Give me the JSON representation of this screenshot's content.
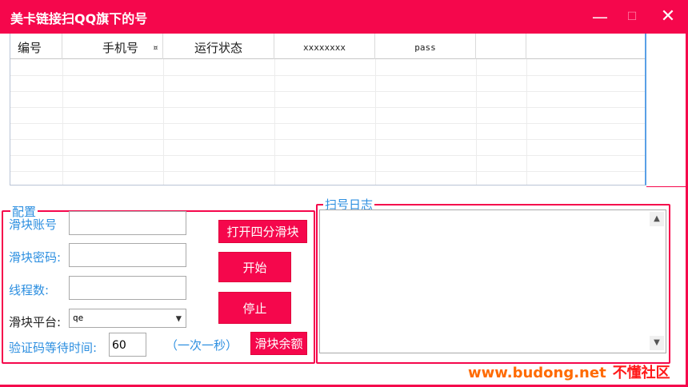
{
  "window": {
    "title": "美卡链接扫QQ旗下的号",
    "minimize": "—",
    "maximize": "☐",
    "close": "✕"
  },
  "grid": {
    "columns": [
      "编号",
      "手机号",
      "¤",
      "运行状态",
      "xxxxxxxx",
      "pass",
      ""
    ],
    "row_count": 8
  },
  "config": {
    "legend": "配置",
    "slider_account_label": "滑块账号",
    "slider_password_label": "滑块密码:",
    "threads_label": "线程数:",
    "platform_label": "滑块平台:",
    "platform_value": "qe",
    "wait_label": "验证码等待时间:",
    "wait_value": "60",
    "wait_hint": "（一次一秒）",
    "open_button": "打开四分滑块",
    "start_button": "开始",
    "stop_button": "停止",
    "balance_button": "滑块余额"
  },
  "log": {
    "legend": "扫号日志",
    "scroll_up": "▲",
    "scroll_down": "▼"
  },
  "watermark": {
    "site": "www.budong.net",
    "name": "不懂社区"
  },
  "colors": {
    "accent": "#f5074c",
    "label_blue": "#2d8fe0"
  }
}
